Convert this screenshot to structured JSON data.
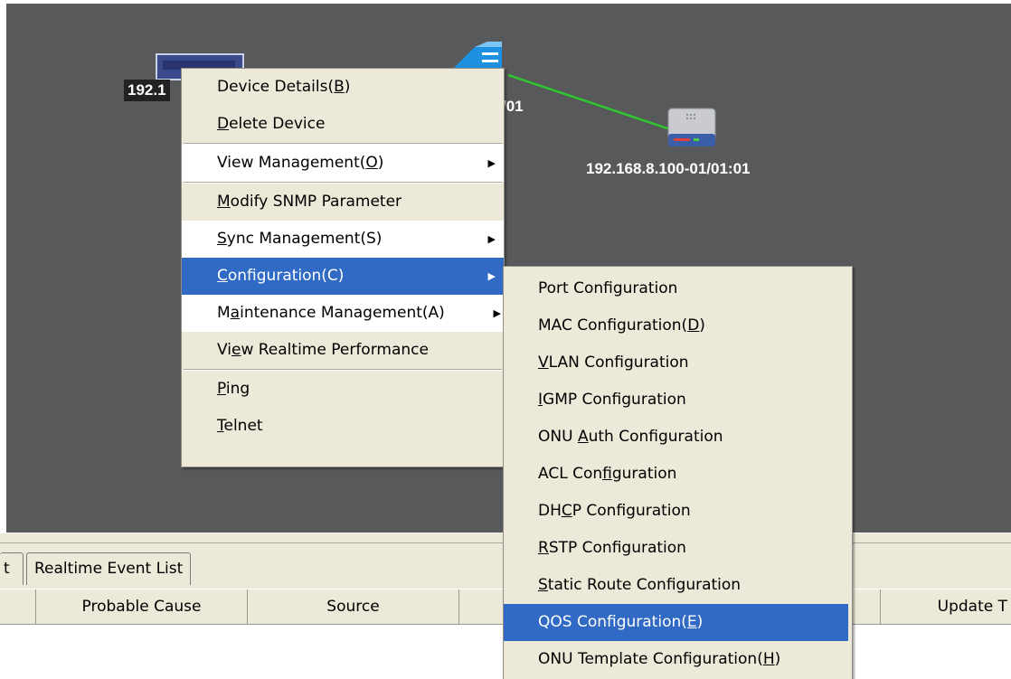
{
  "topology": {
    "nodes": [
      {
        "label": "192.1",
        "icon": "olt-device-icon"
      },
      {
        "label": "/01",
        "icon": "switch-device-icon"
      },
      {
        "label": "192.168.8.100-01/01:01",
        "icon": "onu-device-icon"
      }
    ],
    "link_color": "#2ec82e"
  },
  "context_menu": {
    "items": [
      {
        "pre": "Device Details(",
        "key": "B",
        "post": ")"
      },
      {
        "pre": "",
        "key": "D",
        "post": "elete Device"
      },
      {
        "pre": "View Management(",
        "key": "O",
        "post": ")"
      },
      {
        "pre": "",
        "key": "M",
        "post": "odify SNMP Parameter"
      },
      {
        "pre": "",
        "key": "S",
        "post": "ync Management(S)"
      },
      {
        "pre": "",
        "key": "C",
        "post": "onfiguration(C)"
      },
      {
        "pre": "M",
        "key": "a",
        "post": "intenance Management(A)"
      },
      {
        "pre": "Vi",
        "key": "e",
        "post": "w Realtime Performance"
      },
      {
        "pre": "",
        "key": "P",
        "post": "ing"
      },
      {
        "pre": "",
        "key": "T",
        "post": "elnet"
      }
    ]
  },
  "config_submenu": {
    "items": [
      {
        "pre": "Port Confi",
        "key": "g",
        "post": "uration"
      },
      {
        "pre": "MAC Configuration(",
        "key": "D",
        "post": ")"
      },
      {
        "pre": "",
        "key": "V",
        "post": "LAN Configuration"
      },
      {
        "pre": "",
        "key": "I",
        "post": "GMP Configuration"
      },
      {
        "pre": "ONU ",
        "key": "A",
        "post": "uth Configuration"
      },
      {
        "pre": "ACL Con",
        "key": "f",
        "post": "iguration"
      },
      {
        "pre": "DH",
        "key": "C",
        "post": "P Configuration"
      },
      {
        "pre": "",
        "key": "R",
        "post": "STP Configuration"
      },
      {
        "pre": "",
        "key": "S",
        "post": "tatic Route Configuration"
      },
      {
        "pre": "QOS Configuration(",
        "key": "E",
        "post": ")"
      },
      {
        "pre": "ONU Template Configuration(",
        "key": "H",
        "post": ")"
      }
    ]
  },
  "bottom_panel": {
    "tabs": [
      "t",
      "Realtime Event List"
    ],
    "columns": [
      "",
      "Probable Cause",
      "Source",
      "",
      "",
      "Update T"
    ]
  },
  "colors": {
    "canvas_bg": "#58595b",
    "menu_bg": "#ece9d8",
    "highlight": "#316ac5"
  }
}
